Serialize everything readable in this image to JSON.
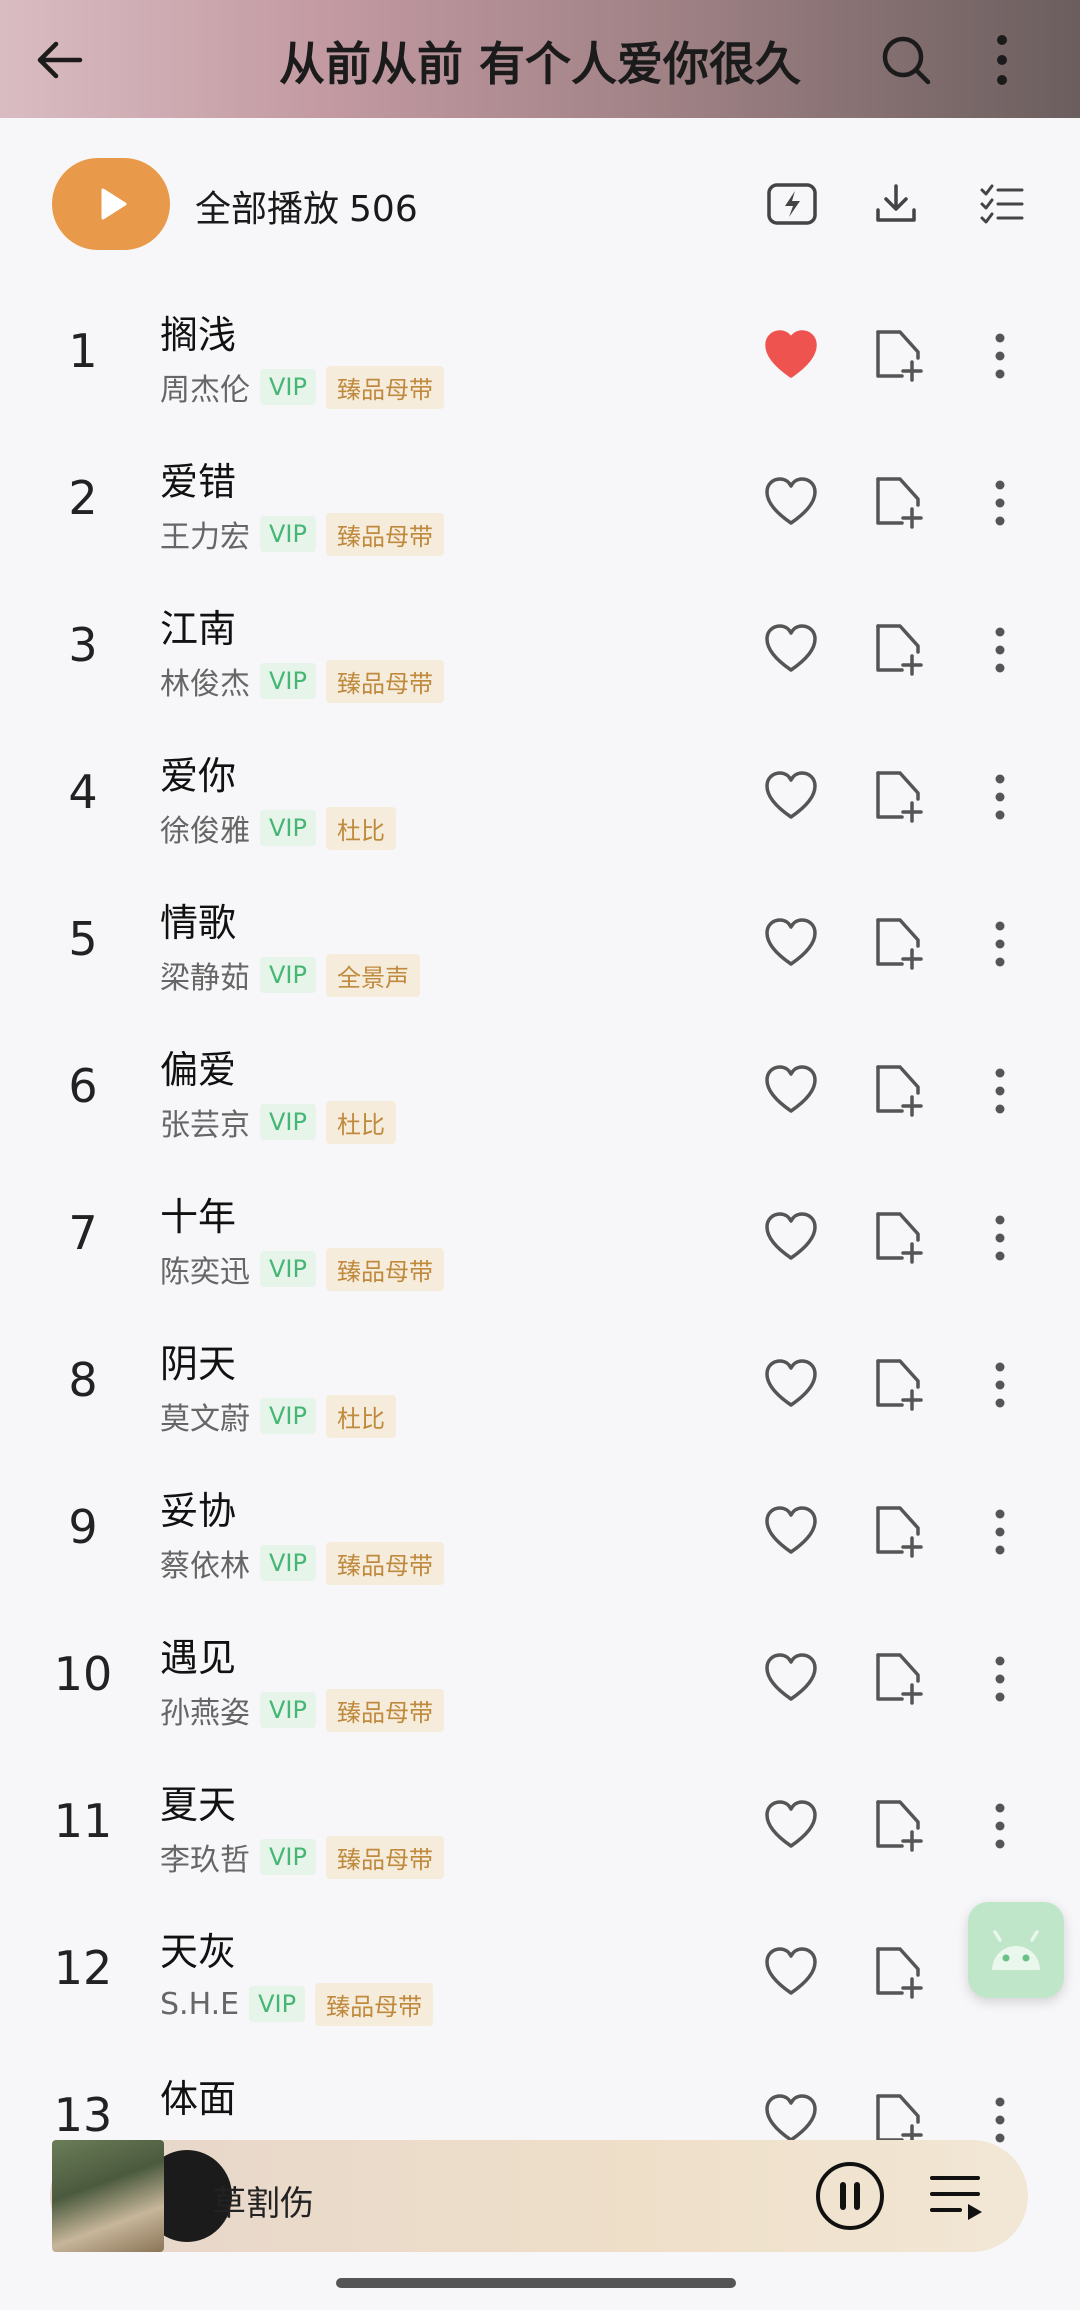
{
  "header": {
    "title": "从前从前 有个人爱你很久",
    "back_icon": "arrow-left-icon",
    "search_icon": "search-icon",
    "more_icon": "more-vertical-icon"
  },
  "toolbar": {
    "play_all_label": "全部播放",
    "count": "506",
    "icons": [
      "lightning-icon",
      "download-icon",
      "multi-select-icon"
    ]
  },
  "songs": [
    {
      "index": "1",
      "title": "搁浅",
      "artist": "周杰伦",
      "vip": "VIP",
      "quality": "臻品母带",
      "liked": true
    },
    {
      "index": "2",
      "title": "爱错",
      "artist": "王力宏",
      "vip": "VIP",
      "quality": "臻品母带",
      "liked": false
    },
    {
      "index": "3",
      "title": "江南",
      "artist": "林俊杰",
      "vip": "VIP",
      "quality": "臻品母带",
      "liked": false
    },
    {
      "index": "4",
      "title": "爱你",
      "artist": "徐俊雅",
      "vip": "VIP",
      "quality": "杜比",
      "liked": false
    },
    {
      "index": "5",
      "title": "情歌",
      "artist": "梁静茹",
      "vip": "VIP",
      "quality": "全景声",
      "liked": false
    },
    {
      "index": "6",
      "title": "偏爱",
      "artist": "张芸京",
      "vip": "VIP",
      "quality": "杜比",
      "liked": false
    },
    {
      "index": "7",
      "title": "十年",
      "artist": "陈奕迅",
      "vip": "VIP",
      "quality": "臻品母带",
      "liked": false
    },
    {
      "index": "8",
      "title": "阴天",
      "artist": "莫文蔚",
      "vip": "VIP",
      "quality": "杜比",
      "liked": false
    },
    {
      "index": "9",
      "title": "妥协",
      "artist": "蔡依林",
      "vip": "VIP",
      "quality": "臻品母带",
      "liked": false
    },
    {
      "index": "10",
      "title": "遇见",
      "artist": "孙燕姿",
      "vip": "VIP",
      "quality": "臻品母带",
      "liked": false
    },
    {
      "index": "11",
      "title": "夏天",
      "artist": "李玖哲",
      "vip": "VIP",
      "quality": "臻品母带",
      "liked": false
    },
    {
      "index": "12",
      "title": "天灰",
      "artist": "S.H.E",
      "vip": "VIP",
      "quality": "臻品母带",
      "liked": false
    },
    {
      "index": "13",
      "title": "体面",
      "artist": "",
      "vip": "",
      "quality": "",
      "liked": false
    }
  ],
  "player": {
    "now_playing": "草割伤",
    "pause_icon": "pause-icon",
    "queue_icon": "playlist-icon"
  },
  "colors": {
    "accent_orange": "#e89a4a",
    "liked_red": "#ef5350",
    "vip_green": "#45b673",
    "quality_gold": "#c08a3e"
  }
}
